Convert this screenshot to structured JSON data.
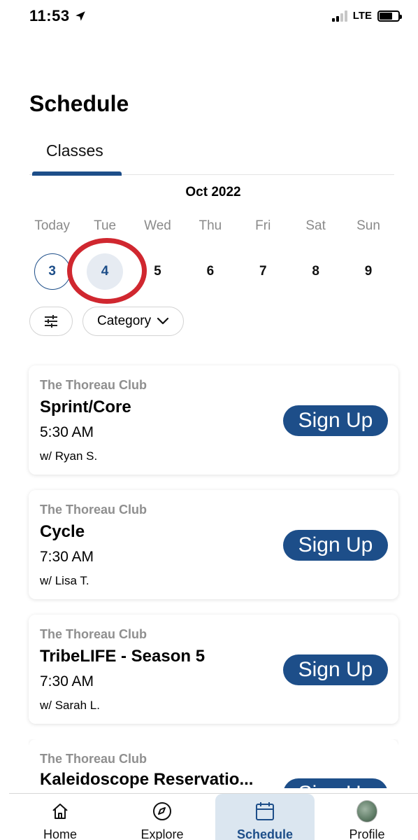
{
  "status": {
    "time": "11:53",
    "network": "LTE"
  },
  "header": {
    "title": "Schedule"
  },
  "tabs": [
    {
      "label": "Classes",
      "active": true
    }
  ],
  "calendar": {
    "month": "Oct 2022",
    "days": [
      "Today",
      "Tue",
      "Wed",
      "Thu",
      "Fri",
      "Sat",
      "Sun"
    ],
    "dates": [
      "3",
      "4",
      "5",
      "6",
      "7",
      "8",
      "9"
    ],
    "selected_date": "4"
  },
  "filters": {
    "category_label": "Category"
  },
  "classes": [
    {
      "club": "The Thoreau Club",
      "name": "Sprint/Core",
      "time": "5:30 AM",
      "instructor": "w/ Ryan S.",
      "action": "Sign Up"
    },
    {
      "club": "The Thoreau Club",
      "name": "Cycle",
      "time": "7:30 AM",
      "instructor": "w/ Lisa T.",
      "action": "Sign Up"
    },
    {
      "club": "The Thoreau Club",
      "name": "TribeLIFE - Season 5",
      "time": "7:30 AM",
      "instructor": "w/ Sarah L.",
      "action": "Sign Up"
    },
    {
      "club": "The Thoreau Club",
      "name": "Kaleidoscope Reservatio...",
      "action": "Sign Up"
    }
  ],
  "nav": [
    {
      "label": "Home",
      "icon": "home-icon"
    },
    {
      "label": "Explore",
      "icon": "compass-icon"
    },
    {
      "label": "Schedule",
      "icon": "calendar-icon",
      "active": true
    },
    {
      "label": "Profile",
      "icon": "avatar"
    }
  ],
  "colors": {
    "accent": "#1d4e89",
    "annotation": "#d0272f",
    "muted": "#8a8a8a"
  }
}
